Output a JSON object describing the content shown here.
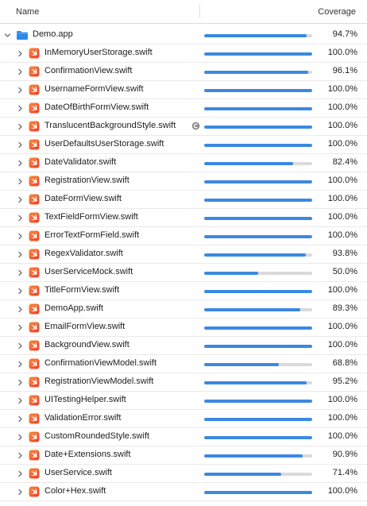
{
  "header": {
    "name_label": "Name",
    "coverage_label": "Coverage"
  },
  "accent_color": "#3b89e0",
  "root": {
    "label": "Demo.app",
    "percent": "94.7%",
    "value": 0.947,
    "icon": "folder-icon"
  },
  "files": [
    {
      "label": "InMemoryUserStorage.swift",
      "percent": "100.0%",
      "value": 1.0
    },
    {
      "label": "ConfirmationView.swift",
      "percent": "96.1%",
      "value": 0.961
    },
    {
      "label": "UsernameFormView.swift",
      "percent": "100.0%",
      "value": 1.0
    },
    {
      "label": "DateOfBirthFormView.swift",
      "percent": "100.0%",
      "value": 1.0
    },
    {
      "label": "TranslucentBackgroundStyle.swift",
      "percent": "100.0%",
      "value": 1.0,
      "badge": "copy-badge-icon"
    },
    {
      "label": "UserDefaultsUserStorage.swift",
      "percent": "100.0%",
      "value": 1.0
    },
    {
      "label": "DateValidator.swift",
      "percent": "82.4%",
      "value": 0.824
    },
    {
      "label": "RegistrationView.swift",
      "percent": "100.0%",
      "value": 1.0
    },
    {
      "label": "DateFormView.swift",
      "percent": "100.0%",
      "value": 1.0
    },
    {
      "label": "TextFieldFormView.swift",
      "percent": "100.0%",
      "value": 1.0
    },
    {
      "label": "ErrorTextFormField.swift",
      "percent": "100.0%",
      "value": 1.0
    },
    {
      "label": "RegexValidator.swift",
      "percent": "93.8%",
      "value": 0.938
    },
    {
      "label": "UserServiceMock.swift",
      "percent": "50.0%",
      "value": 0.5
    },
    {
      "label": "TitleFormView.swift",
      "percent": "100.0%",
      "value": 1.0
    },
    {
      "label": "DemoApp.swift",
      "percent": "89.3%",
      "value": 0.893
    },
    {
      "label": "EmailFormView.swift",
      "percent": "100.0%",
      "value": 1.0
    },
    {
      "label": "BackgroundView.swift",
      "percent": "100.0%",
      "value": 1.0
    },
    {
      "label": "ConfirmationViewModel.swift",
      "percent": "68.8%",
      "value": 0.688
    },
    {
      "label": "RegistrationViewModel.swift",
      "percent": "95.2%",
      "value": 0.952
    },
    {
      "label": "UITestingHelper.swift",
      "percent": "100.0%",
      "value": 1.0
    },
    {
      "label": "ValidationError.swift",
      "percent": "100.0%",
      "value": 1.0
    },
    {
      "label": "CustomRoundedStyle.swift",
      "percent": "100.0%",
      "value": 1.0
    },
    {
      "label": "Date+Extensions.swift",
      "percent": "90.9%",
      "value": 0.909
    },
    {
      "label": "UserService.swift",
      "percent": "71.4%",
      "value": 0.714
    },
    {
      "label": "Color+Hex.swift",
      "percent": "100.0%",
      "value": 1.0
    }
  ]
}
